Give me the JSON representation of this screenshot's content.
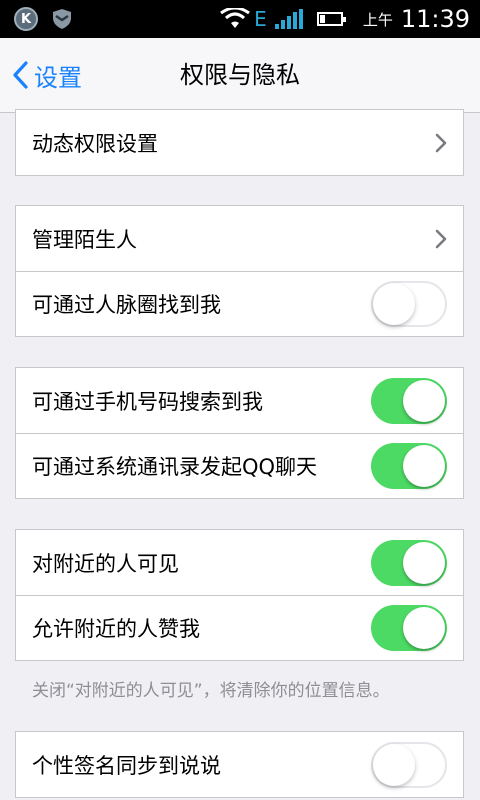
{
  "status_bar": {
    "k_icon_letter": "K",
    "network_type": "E",
    "ampm": "上午",
    "time": "11:39",
    "icons": [
      "k-app-icon",
      "shield-icon",
      "wifi-icon",
      "signal-icon",
      "battery-icon"
    ]
  },
  "nav": {
    "back_label": "设置",
    "title": "权限与隐私"
  },
  "groups": {
    "g1": {
      "row1": {
        "label": "动态权限设置"
      }
    },
    "g2": {
      "row1": {
        "label": "管理陌生人"
      },
      "row2": {
        "label": "可通过人脉圈找到我",
        "toggle": "off"
      }
    },
    "g3": {
      "row1": {
        "label": "可通过手机号码搜索到我",
        "toggle": "on"
      },
      "row2": {
        "label": "可通过系统通讯录发起QQ聊天",
        "toggle": "on"
      }
    },
    "g4": {
      "row1": {
        "label": "对附近的人可见",
        "toggle": "on"
      },
      "row2": {
        "label": "允许附近的人赞我",
        "toggle": "on"
      }
    },
    "g5": {
      "row1": {
        "label": "个性签名同步到说说",
        "toggle": "off"
      }
    }
  },
  "footnote": "关闭“对附近的人可见”，将清除你的位置信息。",
  "colors": {
    "accent": "#1a82fb",
    "toggle_on": "#4cd964",
    "background": "#efeff4",
    "footnote": "#8e8e93"
  }
}
